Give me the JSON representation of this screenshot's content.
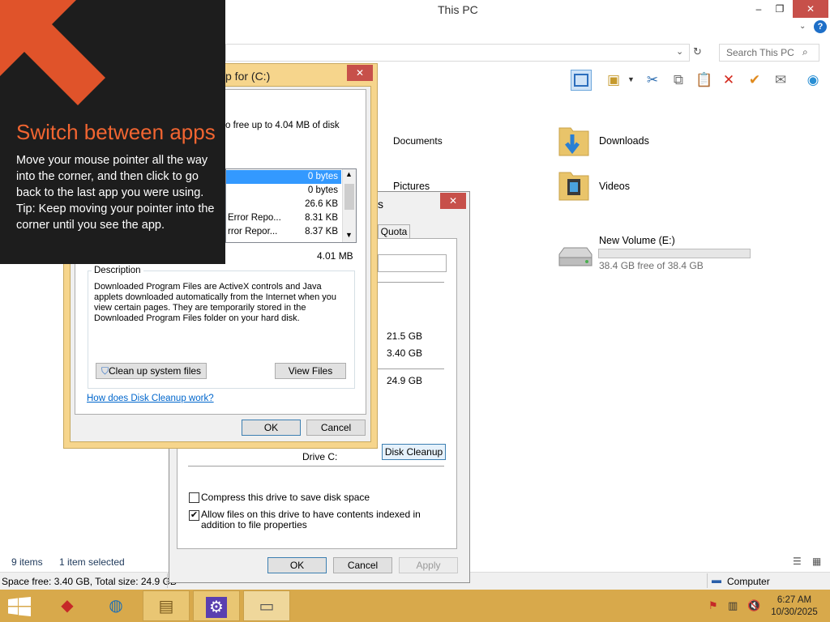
{
  "window": {
    "title": "This PC"
  },
  "search": {
    "placeholder": "Search This PC"
  },
  "items": {
    "documents": "Documents",
    "downloads": "Downloads",
    "pictures": "Pictures",
    "videos": "Videos",
    "drive_name": "New Volume (E:)",
    "drive_free": "38.4 GB free of 38.4 GB",
    "drive_used_fraction": 0.0
  },
  "status": {
    "items_count": "9 items",
    "selected": "1 item selected"
  },
  "space_bar": {
    "space": "Space free: 3.40 GB, Total size: 24.9 GB",
    "location": "Computer"
  },
  "properties": {
    "tab_quota": "Quota",
    "used": "21.5 GB",
    "free": "3.40 GB",
    "capacity": "24.9 GB",
    "drive_label": "Drive C:",
    "disk_cleanup_button": "Disk Cleanup",
    "compress_label": "Compress this drive to save disk space",
    "index_label": "Allow files on this drive to have contents indexed in addition to file properties",
    "ok": "OK",
    "cancel": "Cancel",
    "apply": "Apply"
  },
  "disk_cleanup": {
    "title": "p for  (C:)",
    "intro": "o free up to 4.04 MB of disk",
    "files": [
      {
        "name": "",
        "size": "0 bytes"
      },
      {
        "name": "",
        "size": "0 bytes"
      },
      {
        "name": "",
        "size": "26.6 KB"
      },
      {
        "name": "Error Repo...",
        "size": "8.31 KB"
      },
      {
        "name": "rror Repor...",
        "size": "8.37 KB"
      }
    ],
    "total": "4.01 MB",
    "description_label": "Description",
    "description_text": "Downloaded Program Files are ActiveX controls and Java applets downloaded automatically from the Internet when you view certain pages. They are temporarily stored in the Downloaded Program Files folder on your hard disk.",
    "cleanup_system_button": "Clean up system files",
    "view_files_button": "View Files",
    "help_link": "How does Disk Cleanup work?",
    "ok": "OK",
    "cancel": "Cancel"
  },
  "tip": {
    "heading": "Switch between apps",
    "body": "Move your mouse pointer all the way into the corner, and then click to go back to the last app you were using.",
    "tip_line": "Tip: Keep moving your pointer into the corner until you see the app."
  },
  "clock": {
    "time": "6:27 AM",
    "date": "10/30/2025"
  }
}
